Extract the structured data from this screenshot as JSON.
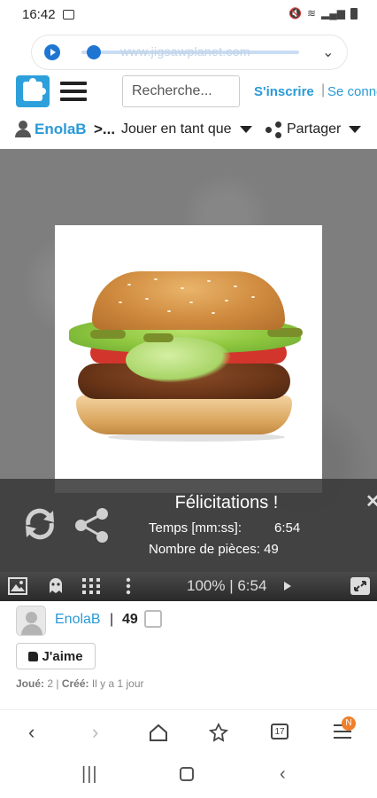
{
  "status_bar": {
    "time": "16:42"
  },
  "media": {
    "url": "www.jigsawplanet.com",
    "progress": 0.05
  },
  "header": {
    "search_placeholder": "Recherche...",
    "signup": "S'inscrire",
    "separator": "|",
    "login": "Se connecter"
  },
  "breadcrumb": {
    "user": "EnolaB",
    "separator": ">...",
    "play_as": "Jouer en tant que",
    "share": "Partager"
  },
  "congrats": {
    "title": "Félicitations !",
    "time_label": "Temps [mm:ss]:",
    "time_value": "6:54",
    "pieces_label": "Nombre de pièces: 49"
  },
  "toolbar": {
    "status": "100% | 6:54"
  },
  "author": {
    "name": "EnolaB",
    "separator": "|",
    "pieces": "49"
  },
  "like": {
    "label": "J'aime"
  },
  "meta": {
    "played_label": "Joué:",
    "played_value": " 2 | ",
    "created_label": "Créé:",
    "created_value": " Il y a 1 jour"
  },
  "browser": {
    "tab_count": "17",
    "badge": "N"
  },
  "colors": {
    "accent": "#2a9ad6",
    "media_blue": "#1f76d2",
    "badge": "#f07f2a"
  }
}
